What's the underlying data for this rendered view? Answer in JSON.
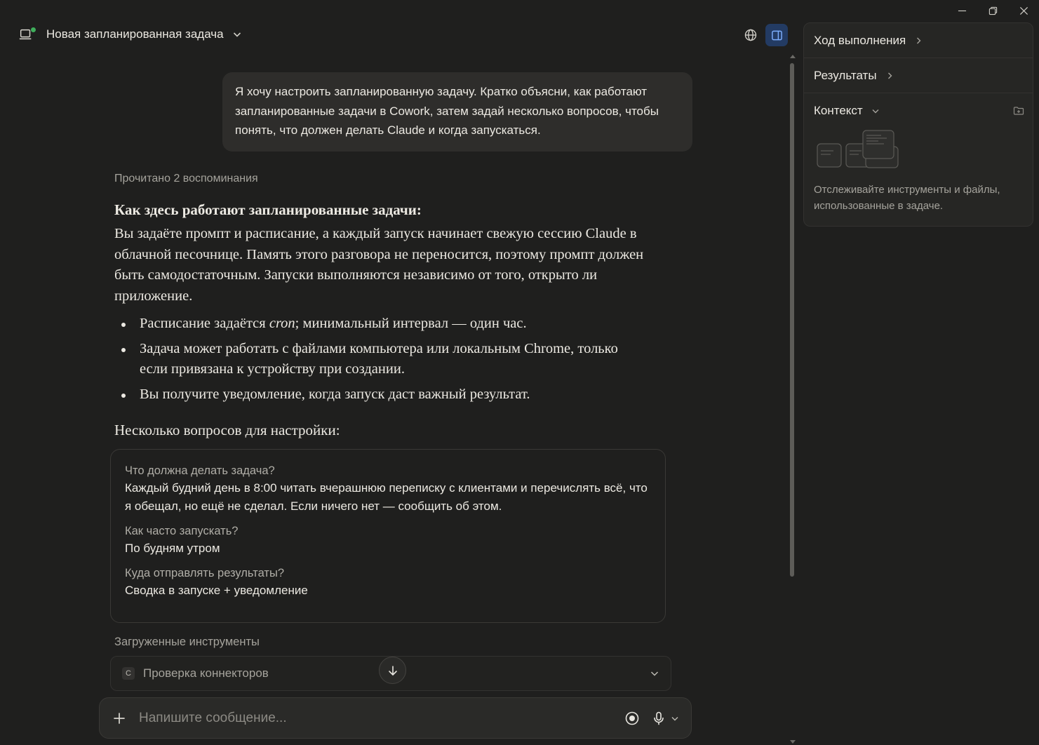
{
  "header": {
    "title": "Новая запланированная задача"
  },
  "conversation": {
    "user_message": "Я хочу настроить запланированную задачу. Кратко объясни, как работают запланированные задачи в Cowork, затем задай несколько вопросов, чтобы понять, что должен делать Claude и когда запускаться.",
    "memory_note": "Прочитано 2 воспоминания",
    "answer": {
      "heading": "Как здесь работают запланированные задачи:",
      "paragraph": "Вы задаёте промпт и расписание, а каждый запуск начинает свежую сессию Claude в облачной песочнице. Память этого разговора не переносится, поэтому промпт должен быть самодостаточным. Запуски выполняются независимо от того, открыто ли приложение.",
      "bullets": {
        "b1_pre": "Расписание задаётся ",
        "b1_em": "cron",
        "b1_post": "; минимальный интервал — один час.",
        "b2": "Задача может работать с файлами компьютера или локальным Chrome, только если привязана к устройству при создании.",
        "b3": "Вы получите уведомление, когда запуск даст важный результат."
      },
      "questions_heading": "Несколько вопросов для настройки:"
    },
    "qa": [
      {
        "question": "Что должна делать задача?",
        "answer": "Каждый будний день в 8:00 читать вчерашнюю переписку с клиентами и перечислять всё, что я обещал, но ещё не сделал. Если ничего нет — сообщить об этом."
      },
      {
        "question": "Как часто запускать?",
        "answer": "По будням утром"
      },
      {
        "question": "Куда отправлять результаты?",
        "answer": "Сводка в запуске + уведомление"
      }
    ],
    "tools_label": "Загруженные инструменты",
    "tool": {
      "badge": "C",
      "name": "Проверка коннекторов"
    }
  },
  "composer": {
    "placeholder": "Напишите сообщение..."
  },
  "side_panel": {
    "progress_label": "Ход выполнения",
    "results_label": "Результаты",
    "context_label": "Контекст",
    "context_description": "Отслеживайте инструменты и файлы, использованные в задаче."
  },
  "colors": {
    "background": "#1f1f1e",
    "panel_button_active": "#233b63",
    "online_dot": "#3fae5b"
  },
  "icons": [
    "laptop-icon",
    "chevron-down-icon",
    "globe-icon",
    "side-panel-icon",
    "arrow-down-icon",
    "plus-icon",
    "record-icon",
    "microphone-icon",
    "chevron-right-icon",
    "folder-plus-icon",
    "minimize-icon",
    "restore-icon",
    "close-icon"
  ]
}
